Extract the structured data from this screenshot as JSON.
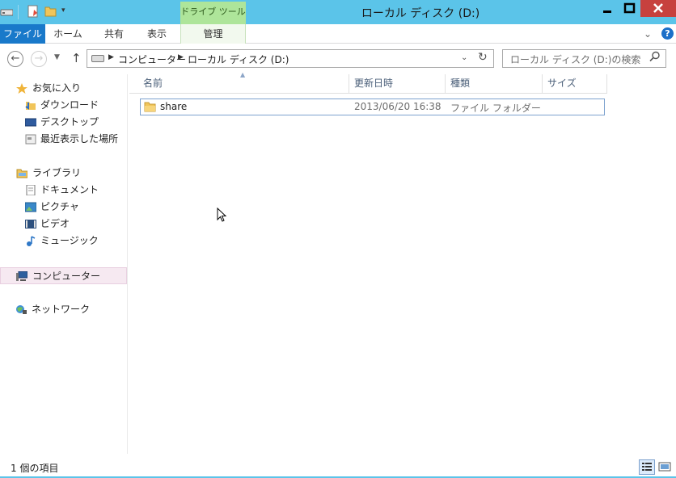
{
  "window": {
    "title": "ローカル ディスク (D:)",
    "context_tab": "ドライブ ツール",
    "controls": [
      "minimize",
      "maximize",
      "close"
    ]
  },
  "ribbon": {
    "tabs": [
      "ファイル",
      "ホーム",
      "共有",
      "表示",
      "管理"
    ],
    "help": "?"
  },
  "address": {
    "crumbs": [
      "コンピューター",
      "ローカル ディスク (D:)"
    ],
    "search_placeholder": "ローカル ディスク (D:)の検索"
  },
  "nav": {
    "favorites": "お気に入り",
    "downloads": "ダウンロード",
    "desktop": "デスクトップ",
    "recent": "最近表示した場所",
    "libraries": "ライブラリ",
    "documents": "ドキュメント",
    "pictures": "ピクチャ",
    "videos": "ビデオ",
    "music": "ミュージック",
    "computer": "コンピューター",
    "network": "ネットワーク"
  },
  "columns": [
    "名前",
    "更新日時",
    "種類",
    "サイズ"
  ],
  "files": [
    {
      "name": "share",
      "modified": "2013/06/20 16:38",
      "type": "ファイル フォルダー",
      "size": ""
    }
  ],
  "status": {
    "text": "1 個の項目"
  },
  "colors": {
    "titlebar": "#5bc4e9",
    "file_tab": "#1979ca",
    "close": "#c7413e",
    "context": "#aee59a"
  },
  "icons": [
    "drive-icon",
    "properties-icon",
    "new-folder-icon",
    "back-icon",
    "forward-icon",
    "up-icon",
    "refresh-icon",
    "search-icon",
    "star-icon",
    "folder-icon",
    "computer-icon",
    "network-icon",
    "help-icon"
  ]
}
